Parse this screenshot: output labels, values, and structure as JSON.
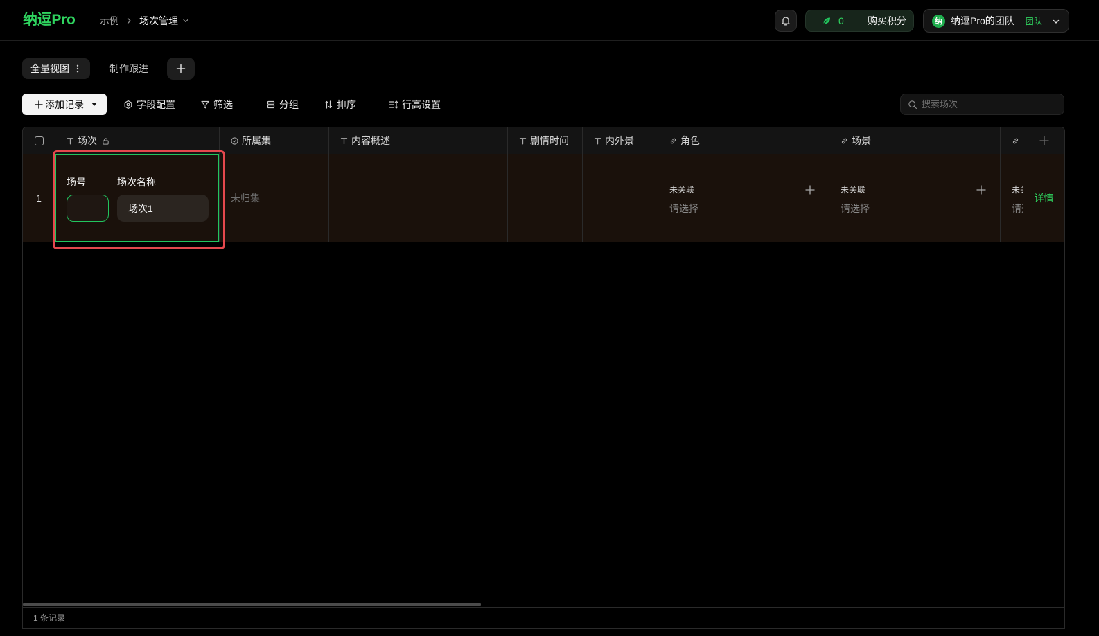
{
  "app": {
    "logo": "纳逗Pro"
  },
  "breadcrumb": {
    "root": "示例",
    "current": "场次管理"
  },
  "header": {
    "points": {
      "value": "0",
      "buy_label": "购买积分",
      "icon": "leaf-icon"
    },
    "team": {
      "avatar": "纳",
      "name": "纳逗Pro的团队",
      "badge": "团队"
    }
  },
  "views": {
    "tabs": [
      {
        "label": "全量视图",
        "active": true
      },
      {
        "label": "制作跟进",
        "active": false
      }
    ]
  },
  "toolbar": {
    "add_record": "添加记录",
    "fields": "字段配置",
    "filter": "筛选",
    "group": "分组",
    "sort": "排序",
    "row_height": "行高设置",
    "search_placeholder": "搜索场次"
  },
  "table": {
    "columns": [
      {
        "label": "场次",
        "type_icon": "text-type-icon",
        "locked": true
      },
      {
        "label": "所属集",
        "type_icon": "check-circle-icon"
      },
      {
        "label": "内容概述",
        "type_icon": "text-type-icon"
      },
      {
        "label": "剧情时间",
        "type_icon": "text-type-icon"
      },
      {
        "label": "内外景",
        "type_icon": "text-type-icon"
      },
      {
        "label": "角色",
        "type_icon": "link-icon"
      },
      {
        "label": "场景",
        "type_icon": "link-icon"
      },
      {
        "type_icon": "link-icon"
      }
    ],
    "rows": [
      {
        "index": "1",
        "scene": {
          "number_label": "场号",
          "number_value": "",
          "name_label": "场次名称",
          "name_value": "场次1"
        },
        "episode": "未归集",
        "roles": {
          "status": "未关联",
          "placeholder": "请选择"
        },
        "sets": {
          "status": "未关联",
          "placeholder": "请选择"
        },
        "extra_link": {
          "status": "未关联",
          "placeholder": "请选择"
        },
        "detail_label": "详情"
      }
    ],
    "footer": "1 条记录"
  },
  "colors": {
    "accent": "#22c55e",
    "highlight": "#e5484d",
    "row_background": "#1a110b",
    "background": "#000000"
  }
}
